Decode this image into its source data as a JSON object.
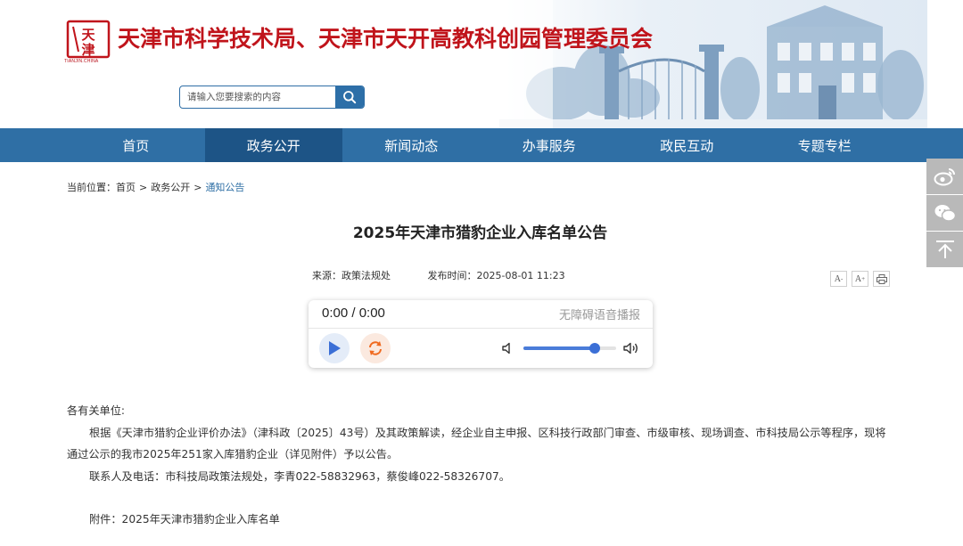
{
  "header": {
    "site_title": "天津市科学技术局、天津市天开高教科创园管理委员会",
    "logo_subtext": "TIANJIN.CHINA",
    "search": {
      "placeholder": "请输入您要搜索的内容"
    }
  },
  "nav": {
    "items": [
      {
        "label": "首页",
        "active": false
      },
      {
        "label": "政务公开",
        "active": true
      },
      {
        "label": "新闻动态",
        "active": false
      },
      {
        "label": "办事服务",
        "active": false
      },
      {
        "label": "政民互动",
        "active": false
      },
      {
        "label": "专题专栏",
        "active": false
      }
    ]
  },
  "breadcrumb": {
    "prefix": "当前位置：",
    "items": [
      "首页",
      "政务公开",
      "通知公告"
    ],
    "separator": ">"
  },
  "article": {
    "title": "2025年天津市猎豹企业入库名单公告",
    "source": "来源：政策法规处",
    "publish_time": "发布时间：2025-08-01 11:23",
    "tools": [
      "A-",
      "A+",
      "print-icon"
    ],
    "salutation": "各有关单位:",
    "paragraph": "根据《天津市猎豹企业评价办法》（津科政〔2025〕43号）及其政策解读，经企业自主申报、区科技行政部门审查、市级审核、现场调查、市科技局公示等程序，现将通过公示的我市2025年251家入库猎豹企业（详见附件）予以公告。",
    "contact": "联系人及电话：市科技局政策法规处，李青022-58832963，蔡俊峰022-58326707。",
    "attachment": "附件：2025年天津市猎豹企业入库名单"
  },
  "player": {
    "time_display": "0:00 / 0:00",
    "accessibility_label": "无障碍语音播报",
    "volume": 0.77,
    "colors": {
      "play": "#3b6fd6",
      "loop": "#f06a1f"
    }
  },
  "side_bar": {
    "icons": [
      "weibo-icon",
      "wechat-icon",
      "back-to-top-icon"
    ]
  },
  "colors": {
    "brand_red": "#c0141b",
    "nav_blue": "#2f6fa5",
    "nav_active": "#1d5486"
  }
}
